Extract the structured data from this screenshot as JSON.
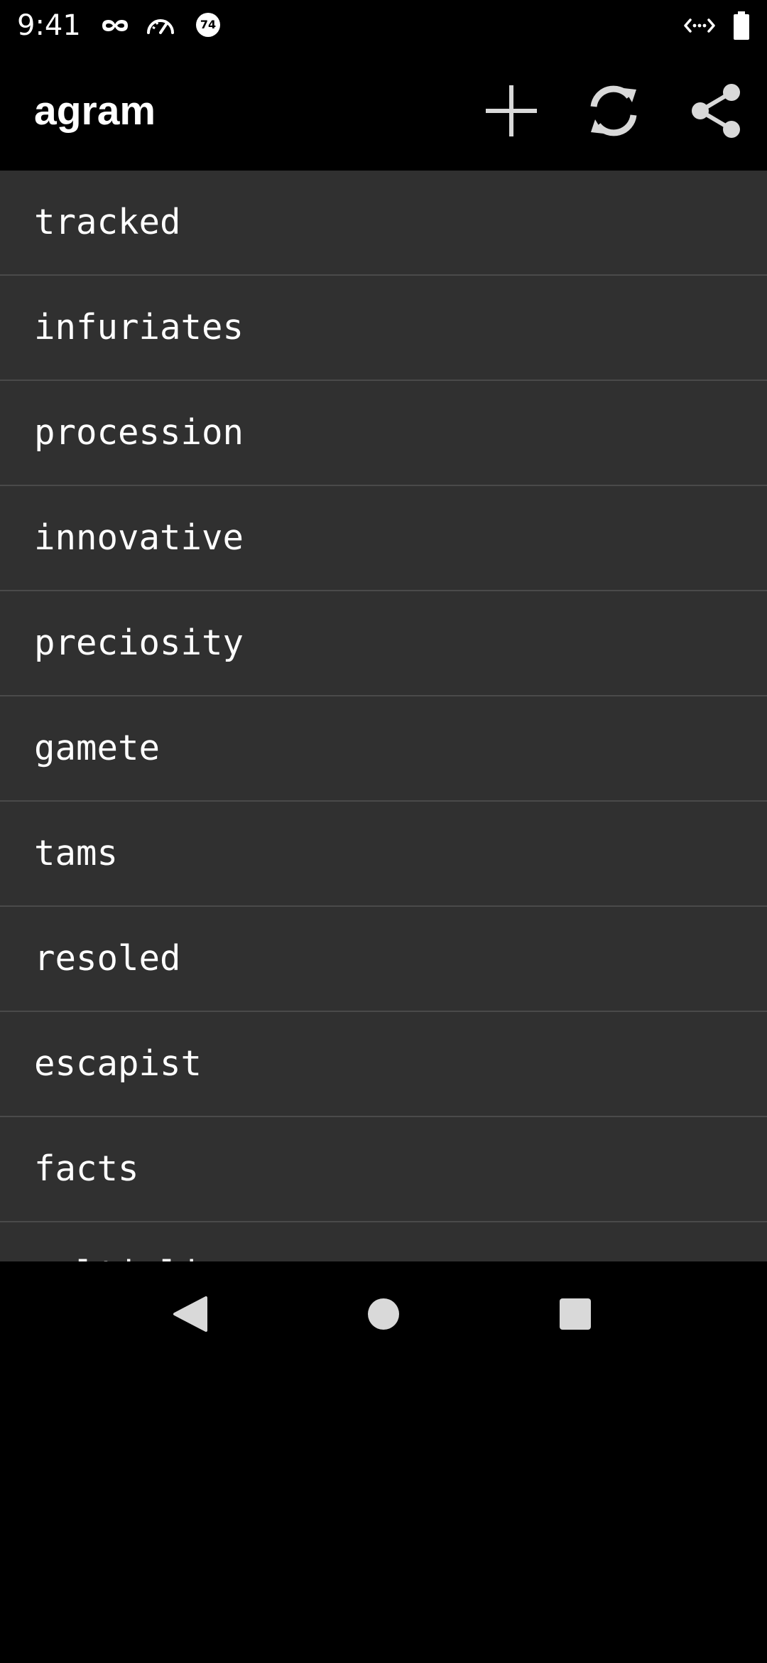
{
  "status_bar": {
    "time": "9:41",
    "left_icons": [
      "incognito-icon",
      "speedometer-icon",
      "counter-badge-icon"
    ],
    "badge_value": "74",
    "right_icons": [
      "code-arrows-icon",
      "battery-icon"
    ]
  },
  "app_bar": {
    "title": "agram",
    "actions": [
      "add-icon",
      "refresh-icon",
      "share-icon"
    ]
  },
  "words": [
    "tracked",
    "infuriates",
    "procession",
    "innovative",
    "preciosity",
    "gamete",
    "tams",
    "resoled",
    "escapist",
    "facts",
    "multiplier"
  ],
  "nav_bar": {
    "buttons": [
      "back-icon",
      "home-icon",
      "recents-icon"
    ]
  },
  "colors": {
    "background": "#000000",
    "list_background": "#303030",
    "divider": "#4a4a4a",
    "icon": "#d9d9d9",
    "text": "#ffffff"
  }
}
